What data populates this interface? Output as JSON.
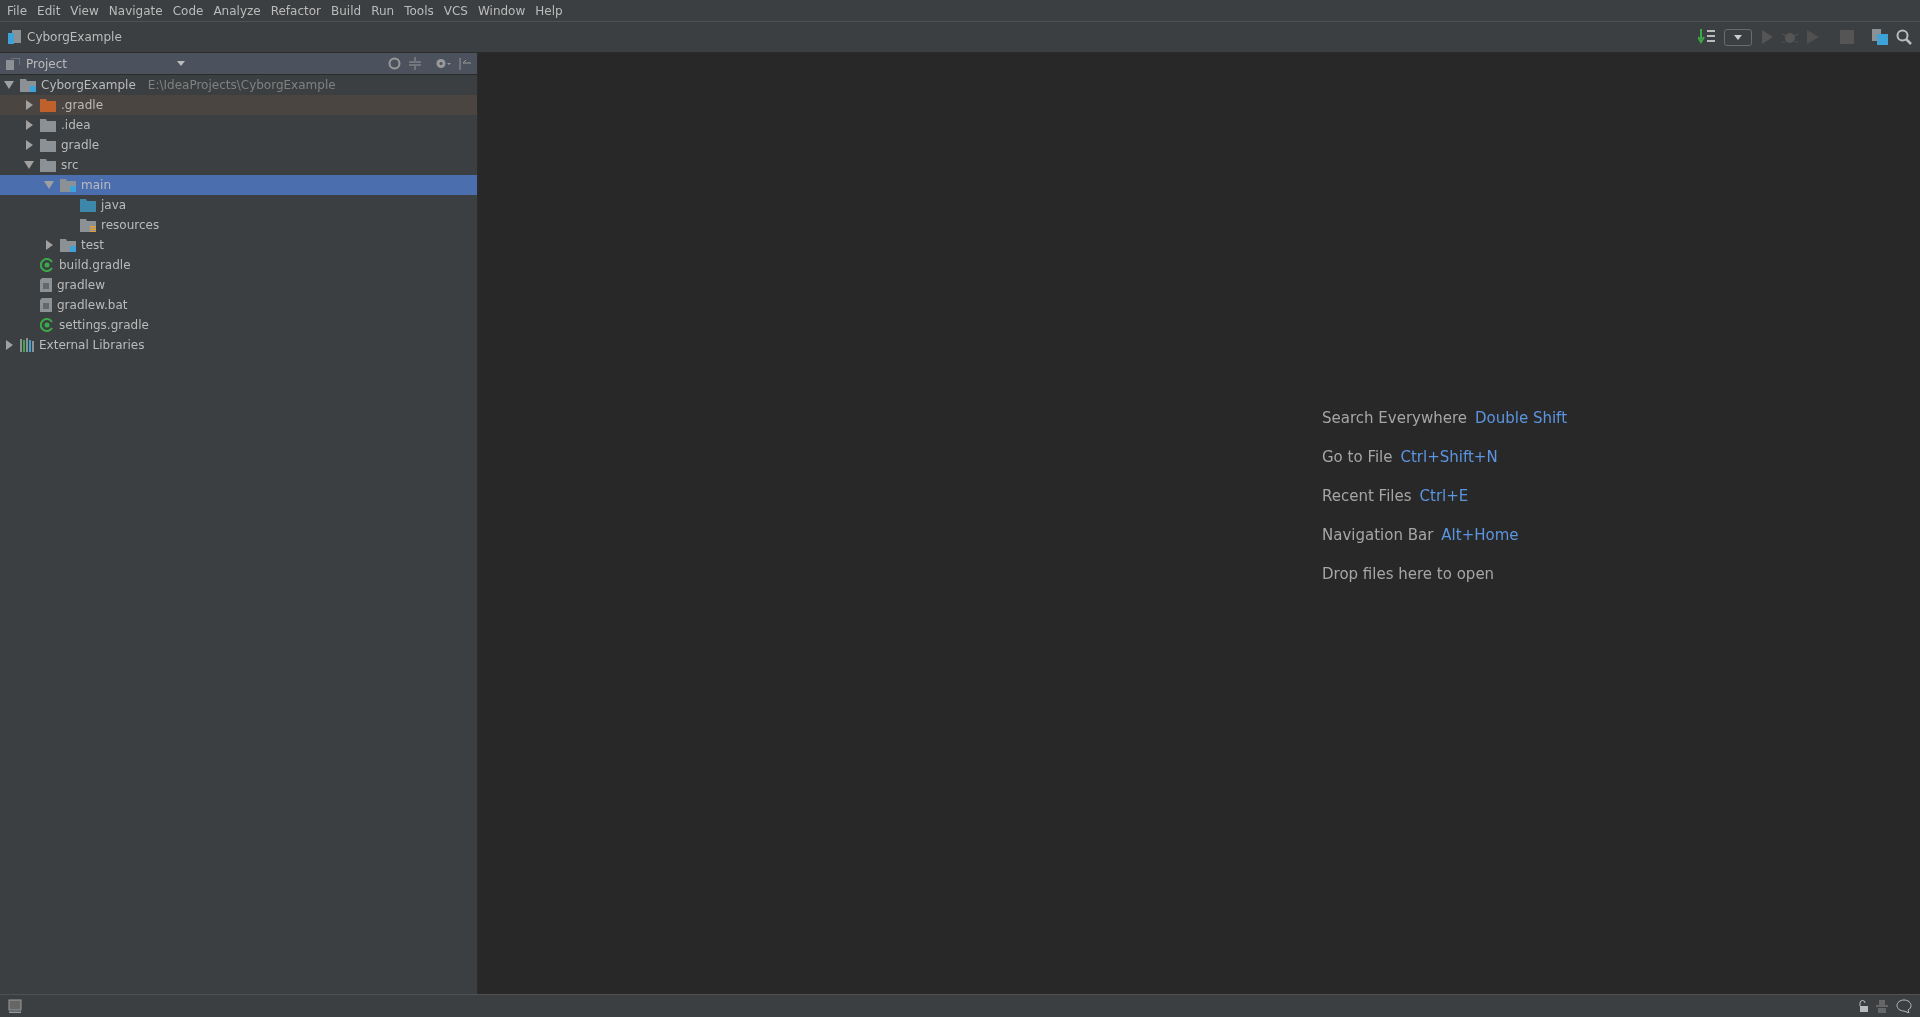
{
  "menu": [
    {
      "label": "File"
    },
    {
      "label": "Edit"
    },
    {
      "label": "View"
    },
    {
      "label": "Navigate"
    },
    {
      "label": "Code"
    },
    {
      "label": "Analyze"
    },
    {
      "label": "Refactor"
    },
    {
      "label": "Build"
    },
    {
      "label": "Run"
    },
    {
      "label": "Tools"
    },
    {
      "label": "VCS"
    },
    {
      "label": "Window"
    },
    {
      "label": "Help"
    }
  ],
  "breadcrumb": "CyborgExample",
  "project_panel": {
    "title": "Project",
    "tree": [
      {
        "label": "CyborgExample",
        "path": "E:\\IdeaProjects\\CyborgExample",
        "kind": "module",
        "expanded": true,
        "selected": false,
        "highlighted": false,
        "children": [
          {
            "label": ".gradle",
            "kind": "excluded-folder",
            "expanded": false,
            "selected": false,
            "highlighted": true
          },
          {
            "label": ".idea",
            "kind": "folder",
            "expanded": false,
            "selected": false,
            "highlighted": false
          },
          {
            "label": "gradle",
            "kind": "folder",
            "expanded": false,
            "selected": false,
            "highlighted": false
          },
          {
            "label": "src",
            "kind": "folder",
            "expanded": true,
            "selected": false,
            "highlighted": false,
            "children": [
              {
                "label": "main",
                "kind": "module-folder",
                "expanded": true,
                "selected": true,
                "highlighted": false,
                "children": [
                  {
                    "label": "java",
                    "kind": "source-folder",
                    "selected": false,
                    "highlighted": false
                  },
                  {
                    "label": "resources",
                    "kind": "resource-folder",
                    "selected": false,
                    "highlighted": false
                  }
                ]
              },
              {
                "label": "test",
                "kind": "module-folder",
                "expanded": false,
                "selected": false,
                "highlighted": false
              }
            ]
          },
          {
            "label": "build.gradle",
            "kind": "gradle-file",
            "selected": false,
            "highlighted": false
          },
          {
            "label": "gradlew",
            "kind": "file",
            "selected": false,
            "highlighted": false
          },
          {
            "label": "gradlew.bat",
            "kind": "file",
            "selected": false,
            "highlighted": false
          },
          {
            "label": "settings.gradle",
            "kind": "gradle-file",
            "selected": false,
            "highlighted": false
          }
        ]
      },
      {
        "label": "External Libraries",
        "kind": "libraries",
        "expanded": false,
        "selected": false,
        "highlighted": false
      }
    ]
  },
  "editor_hints": [
    {
      "action": "Search Everywhere",
      "shortcut": "Double Shift"
    },
    {
      "action": "Go to File",
      "shortcut": "Ctrl+Shift+N"
    },
    {
      "action": "Recent Files",
      "shortcut": "Ctrl+E"
    },
    {
      "action": "Navigation Bar",
      "shortcut": "Alt+Home"
    },
    {
      "action": "Drop files here to open"
    }
  ]
}
